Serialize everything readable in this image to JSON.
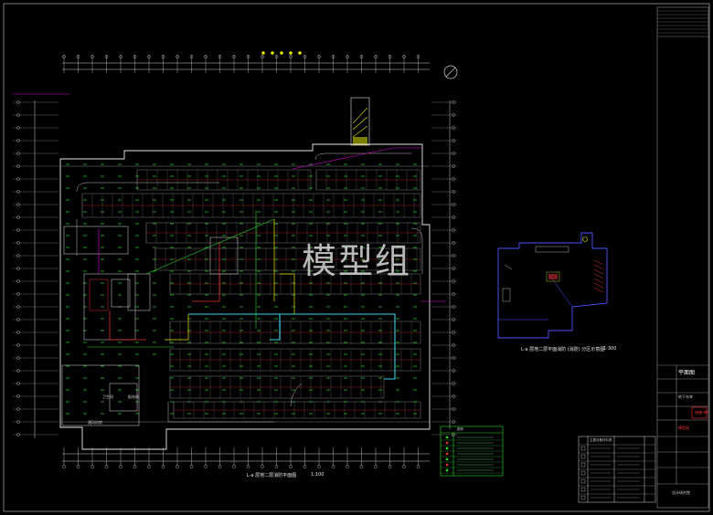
{
  "watermark": "模型组",
  "main_plan": {
    "caption": "L-a 层地二层消防平面图",
    "scale": "1:100",
    "zone_labels": [
      "卫生间",
      "配电间",
      "通风机房"
    ]
  },
  "keyplan": {
    "caption": "L-a 层地二层平面消防 (消防) 分区示意图",
    "scale": "1:300"
  },
  "title_block": {
    "drawing_name": "平面图",
    "project": "地下车库",
    "stamp_text": "模型组",
    "company": "设计研究院",
    "drawing_no": "电施-09"
  },
  "legend": {
    "title": "图例",
    "rows": [
      "应急照明",
      "疏散指示",
      "安全出口",
      "感烟探测器",
      "手动报警",
      "声光报警",
      "消防广播"
    ]
  },
  "table": {
    "title": "主要设备材料表",
    "rows": [
      "1",
      "2",
      "3",
      "4",
      "5",
      "6",
      "7"
    ]
  },
  "colors": {
    "background": "#000000",
    "wall": "#e0e0e0",
    "fixture": "#2bd62b",
    "route_cyan": "#39d3e6",
    "route_red": "#e03030",
    "route_magenta": "#e000e0",
    "route_yellow": "#e6e600",
    "keyplan_blue": "#4a55ff"
  }
}
